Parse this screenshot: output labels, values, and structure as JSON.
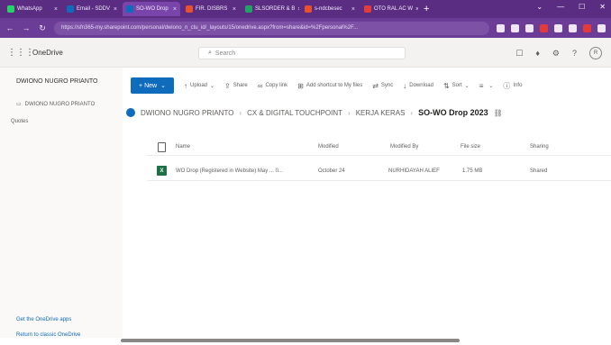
{
  "browser": {
    "tabs": [
      {
        "label": "WhatsApp",
        "color": "#25d366",
        "active": false
      },
      {
        "label": "Email - SDDV",
        "color": "#0f6cbd",
        "active": false
      },
      {
        "label": "SO-WO Drop",
        "color": "#0f6cbd",
        "active": true
      },
      {
        "label": "FIR. DISBRS",
        "color": "#e8502e",
        "active": false
      },
      {
        "label": "SLSORDER & B",
        "color": "#21a366",
        "active": false
      },
      {
        "label": "s-ndcbesec",
        "color": "#e8502e",
        "active": false
      },
      {
        "label": "OTO RAL AC W",
        "color": "#e23b3b",
        "active": false
      }
    ],
    "new_tab": "+",
    "url": "https://sfn365-my.sharepoint.com/personal/dwiono_n_ctu_id/_layouts/15/onedrive.aspx?from=share&id=%2Fpersonal%2F..."
  },
  "suite": {
    "app_name": "OneDrive",
    "search_placeholder": "Search",
    "avatar_initial": "R"
  },
  "leftnav": {
    "user": "DWIONO NUGRO PRIANTO",
    "item": "DWIONO NUGRO PRIANTO",
    "section": "Quotes",
    "footer_link1": "Get the OneDrive apps",
    "footer_link2": "Return to classic OneDrive"
  },
  "commands": {
    "new": "+ New",
    "upload": "Upload",
    "share": "Share",
    "copy_link": "Copy link",
    "add_shortcut": "Add shortcut to My files",
    "sync": "Sync",
    "download": "Download",
    "sort": "Sort",
    "view": "",
    "info": "Info"
  },
  "breadcrumb": [
    "DWIONO NUGRO PRIANTO",
    "CX & DIGITAL TOUCHPOINT",
    "KERJA KERAS",
    "SO-WO Drop 2023"
  ],
  "table": {
    "columns": [
      "Name",
      "Modified",
      "Modified By",
      "File size",
      "Sharing"
    ],
    "rows": [
      {
        "name": "WO Drop (Registered in Website) May ... 0...",
        "modified": "October 24",
        "modified_by": "NURHIDAYAH ALIEF",
        "size": "1.75 MB",
        "sharing": "Shared"
      }
    ]
  }
}
